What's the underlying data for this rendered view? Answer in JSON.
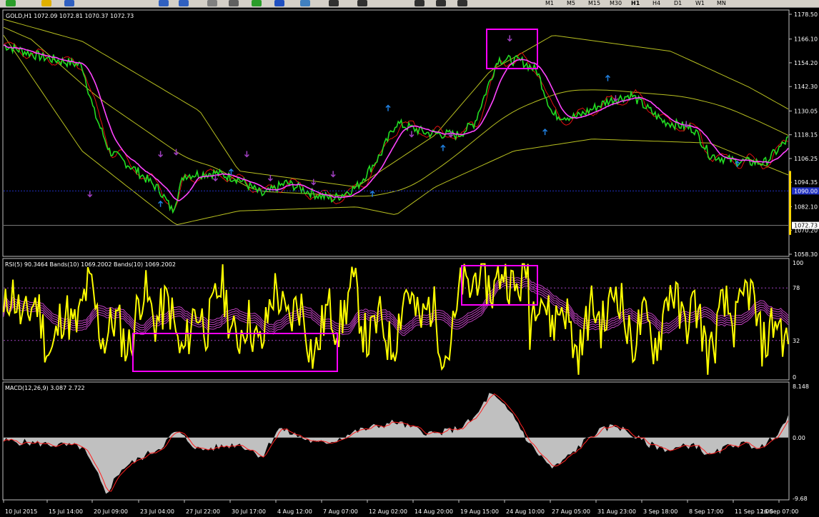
{
  "toolbar": {
    "timeframes": [
      "M1",
      "M5",
      "M15",
      "M30",
      "H1",
      "H4",
      "D1",
      "W1",
      "MN"
    ],
    "active_timeframe": "H1",
    "icons": [
      "new-chart-icon",
      "favorites-icon",
      "open-icon",
      "zoom-in-icon",
      "zoom-out-icon",
      "chart-period-icon",
      "grid-icon",
      "indicator-add-icon",
      "refresh-icon",
      "template-icon",
      "cursor-icon",
      "crosshair-icon",
      "trendline-icon",
      "text-icon",
      "label-icon"
    ]
  },
  "main_chart": {
    "title": "GOLD,H1  1072.09 1072.81 1070.37 1072.73",
    "price_labels": [
      "1178.50",
      "1166.10",
      "1154.20",
      "1142.30",
      "1130.05",
      "1118.15",
      "1106.25",
      "1094.35",
      "1082.10",
      "1070.20",
      "1058.30"
    ],
    "current_price": "1072.73",
    "bid_line_label": "1090.00"
  },
  "rsi_panel": {
    "title": "RSI(5) 90.3464  Bands(10) 1069.2002  Bands(10) 1069.2002",
    "levels": [
      "100",
      "78",
      "32",
      "0"
    ]
  },
  "macd_panel": {
    "title": "MACD(12,26,9) 3.087 2.722",
    "levels": [
      "8.148",
      "0.00",
      "-9.68"
    ]
  },
  "time_axis": [
    "10 Jul 2015",
    "15 Jul 14:00",
    "20 Jul 09:00",
    "23 Jul 04:00",
    "27 Jul 22:00",
    "30 Jul 17:00",
    "4 Aug 12:00",
    "7 Aug 07:00",
    "12 Aug 02:00",
    "14 Aug 20:00",
    "19 Aug 15:00",
    "24 Aug 10:00",
    "27 Aug 05:00",
    "31 Aug 23:00",
    "3 Sep 18:00",
    "8 Sep 17:00",
    "11 Sep 12:00",
    "16 Sep 07:00"
  ],
  "colors": {
    "price": "#22dd22",
    "ma_fast": "#ff44ff",
    "ma_slow": "#e01010",
    "bands": "#b8c020",
    "rsi": "#ffff00",
    "highlight_box": "#ff00ff",
    "macd_hist": "#c0c0c0",
    "macd_signal": "#ff2020",
    "grid_text": "#ffffff"
  }
}
